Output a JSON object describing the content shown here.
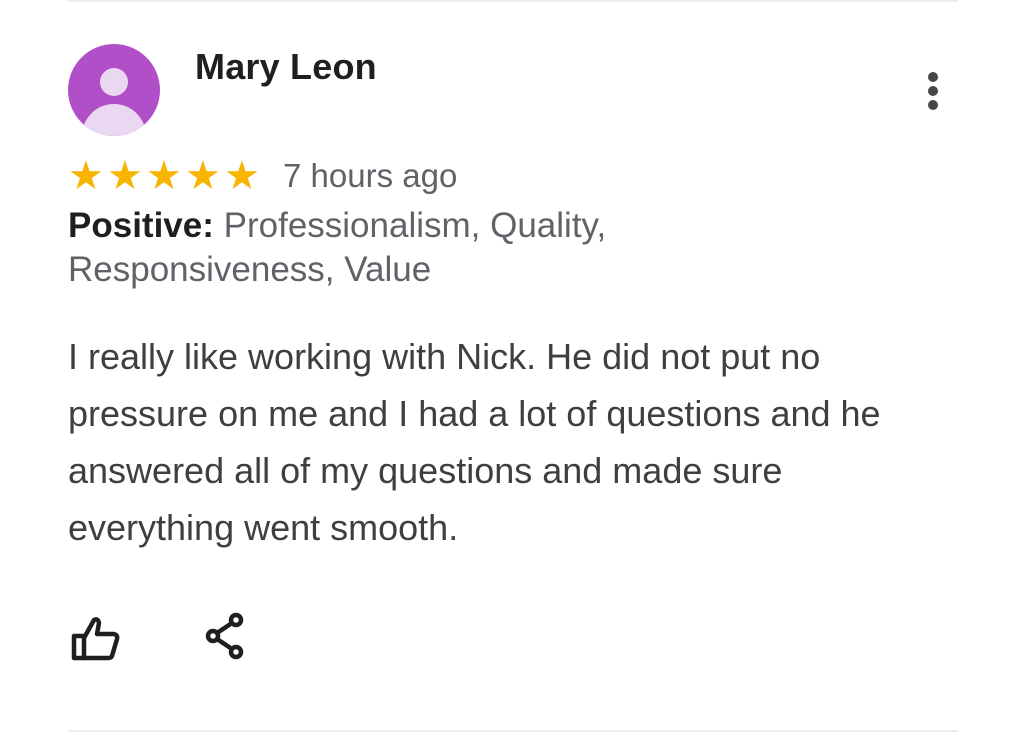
{
  "review": {
    "reviewer_name": "Mary Leon",
    "avatar_color": "#b04fc7",
    "rating": 5,
    "rating_max": 5,
    "star_color": "#f7b500",
    "time_ago": "7 hours ago",
    "positive_label": "Positive:",
    "positive_values": "Professionalism, Quality, Responsiveness, Value",
    "text": "I really like working with Nick. He did not put no pressure on me and I had a lot of questions and he answered all of my questions and made sure everything went smooth."
  },
  "icons": {
    "more": "more-vertical-icon",
    "like": "thumbs-up-icon",
    "share": "share-icon",
    "star": "star-icon",
    "avatar": "person-icon"
  }
}
